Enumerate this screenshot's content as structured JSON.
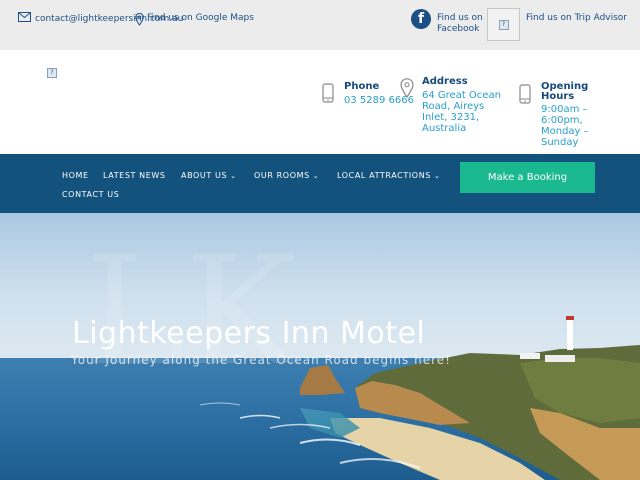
{
  "topbar": {
    "email": "contact@lightkeepersinn.com.au",
    "maps_label": "Find us on Google Maps",
    "facebook_label": "Find us on Facebook",
    "tripadvisor_label": "Find us on Trip Advisor",
    "tripadvisor_image_alt": "?"
  },
  "header": {
    "logo_alt": "?",
    "phone": {
      "title": "Phone",
      "value": "03 5289 6666"
    },
    "address": {
      "title": "Address",
      "value": "64 Great Ocean Road, Aireys Inlet, 3231, Australia"
    },
    "hours": {
      "title": "Opening Hours",
      "value": "9:00am – 6:00pm, Monday – Sunday"
    }
  },
  "nav": {
    "items": [
      {
        "label": "HOME",
        "has_dropdown": false
      },
      {
        "label": "LATEST NEWS",
        "has_dropdown": false
      },
      {
        "label": "ABOUT US",
        "has_dropdown": true
      },
      {
        "label": "OUR ROOMS",
        "has_dropdown": true
      },
      {
        "label": "LOCAL ATTRACTIONS",
        "has_dropdown": true
      },
      {
        "label": "CONTACT US",
        "has_dropdown": false
      }
    ],
    "caret": "⌄",
    "booking_button": "Make a Booking"
  },
  "hero": {
    "watermark": "LK",
    "title": "Lightkeepers Inn Motel",
    "subtitle": "Your Journey along the Great Ocean Road begins here!"
  },
  "colors": {
    "brand_blue": "#13527d",
    "accent_green": "#1ab98f",
    "link_blue": "#2a9fc9",
    "topbar_bg": "#ececec"
  },
  "icons": {
    "email": "envelope-icon",
    "maps": "map-pin-icon",
    "facebook": "facebook-icon",
    "phone": "mobile-phone-icon",
    "address": "location-pin-icon",
    "hours": "mobile-phone-icon"
  }
}
